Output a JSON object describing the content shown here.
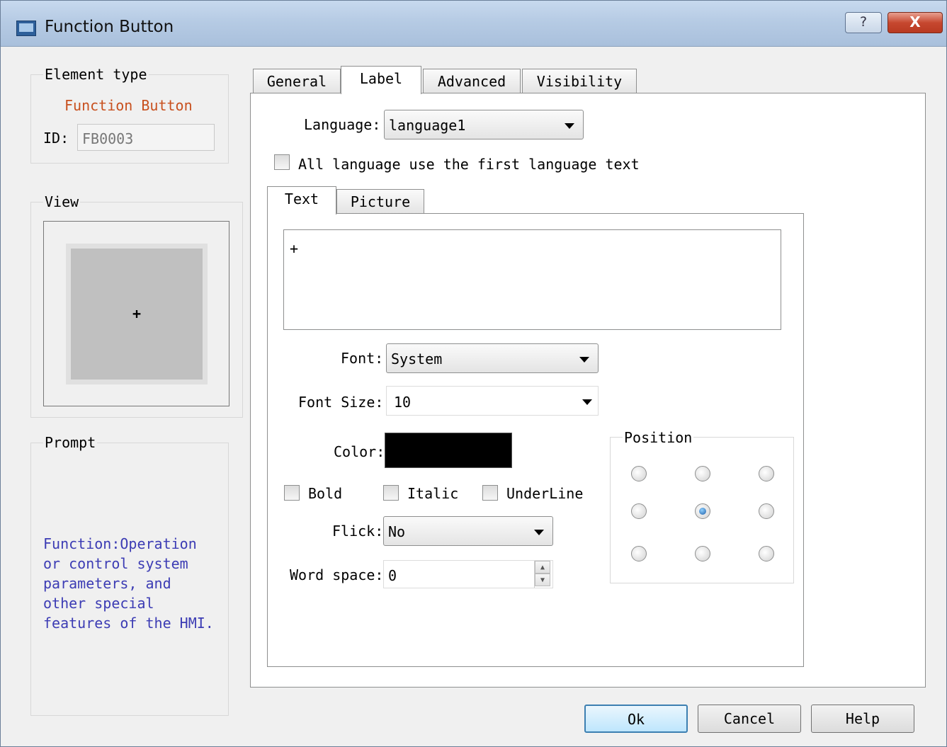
{
  "window": {
    "title": "Function Button",
    "help_label": "?",
    "close_label": "X"
  },
  "left": {
    "element_type_title": "Element type",
    "element_type_value": "Function Button",
    "id_label": "ID:",
    "id_value": "FB0003",
    "view_title": "View",
    "view_preview_text": "+",
    "prompt_title": "Prompt",
    "prompt_lines": [
      "Function:Operation",
      "or control system",
      "parameters, and",
      "other special",
      "features of the HMI."
    ]
  },
  "tabs": [
    {
      "label": "General"
    },
    {
      "label": "Label"
    },
    {
      "label": "Advanced"
    },
    {
      "label": "Visibility"
    }
  ],
  "label_tab": {
    "language_label": "Language:",
    "language_value": "language1",
    "all_language_label": "All language use the first language text",
    "subtabs": [
      {
        "label": "Text"
      },
      {
        "label": "Picture"
      }
    ],
    "text_value": "+",
    "font_label": "Font:",
    "font_value": "System",
    "font_size_label": "Font Size:",
    "font_size_value": "10",
    "color_label": "Color:",
    "color_value": "#000000",
    "bold_label": "Bold",
    "italic_label": "Italic",
    "underline_label": "UnderLine",
    "flick_label": "Flick:",
    "flick_value": "No",
    "word_space_label": "Word space:",
    "word_space_value": "0",
    "position_title": "Position",
    "position_selected": "middle-center"
  },
  "buttons": {
    "ok": "Ok",
    "cancel": "Cancel",
    "help": "Help"
  },
  "colors": {
    "element_type_value": "#c8501e",
    "prompt_text": "#3c3cb4",
    "default_button_border": "#3c7fb1"
  }
}
